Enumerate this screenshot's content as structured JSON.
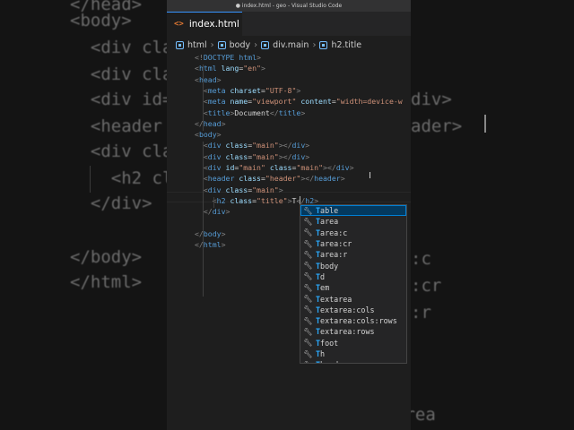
{
  "window": {
    "title": "● index.html - geo - Visual Studio Code"
  },
  "tab": {
    "label": "index.html",
    "icon": "<>"
  },
  "breadcrumb": [
    "html",
    "body",
    "div.main",
    "h2.title"
  ],
  "code_lines": [
    "<!DOCTYPE html>",
    "<html lang=\"en\">",
    "<head>",
    "  <meta charset=\"UTF-8\">",
    "  <meta name=\"viewport\" content=\"width=device-w",
    "  <title>Document</title>",
    "</head>",
    "<body>",
    "  <div class=\"main\"></div>",
    "  <div class=\"main\"></div>",
    "  <div id=\"main\" class=\"main\"></div>",
    "  <header class=\"header\"></header>",
    "  <div class=\"main\">",
    "    <h2 class=\"title\">T</h2>",
    "  </div>",
    "",
    "</body>",
    "</html>"
  ],
  "suggestions": [
    "Table",
    "Tarea",
    "Tarea:c",
    "Tarea:cr",
    "Tarea:r",
    "Tbody",
    "Td",
    "Tem",
    "Textarea",
    "Textarea:cols",
    "Textarea:cols:rows",
    "Textarea:rows",
    "Tfoot",
    "Th",
    "Thead"
  ],
  "background": {
    "lines": [
      "</head>",
      "<body>",
      "  <div cla",
      "  <div cla",
      "  <div id=",
      "  <header",
      "  <div cla",
      "    <h2 cl",
      "  </div>",
      "",
      "",
      "</body>",
      "</html>"
    ],
    "right_fragments": [
      "div>",
      "ader>",
      ":c",
      ":cr",
      ":r",
      "area"
    ]
  },
  "colors": {
    "tag": "#569cd6",
    "attr": "#9cdcfe",
    "value": "#ce9178",
    "selection": "#04395e",
    "accent": "#007fd4"
  }
}
